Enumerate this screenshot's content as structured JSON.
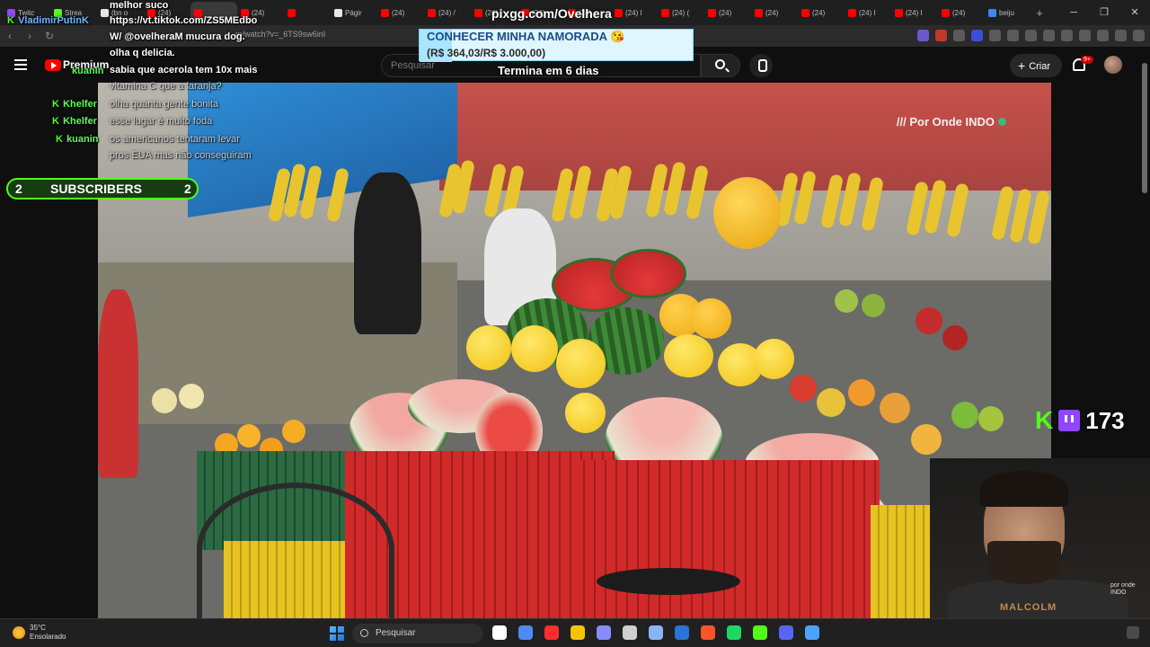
{
  "browser": {
    "tabs": [
      {
        "label": "Twitc",
        "color": "#9146ff"
      },
      {
        "label": "Strea",
        "color": "#53fc18"
      },
      {
        "label": "(bn o",
        "color": "#e6e6e6"
      },
      {
        "label": "(24)",
        "color": "#ff0000"
      },
      {
        "label": "",
        "color": "#ff0000",
        "active": true
      },
      {
        "label": "(24)",
        "color": "#ff0000"
      },
      {
        "label": "",
        "color": "#ff0000"
      },
      {
        "label": "Págir",
        "color": "#e6e6e6"
      },
      {
        "label": "(24)",
        "color": "#ff0000"
      },
      {
        "label": "(24) /",
        "color": "#ff0000"
      },
      {
        "label": "(24) (",
        "color": "#ff0000"
      },
      {
        "label": "(24)",
        "color": "#ff0000"
      },
      {
        "label": "(24)",
        "color": "#ff0000"
      },
      {
        "label": "(24) l",
        "color": "#ff0000"
      },
      {
        "label": "(24) (",
        "color": "#ff0000"
      },
      {
        "label": "(24)",
        "color": "#ff0000"
      },
      {
        "label": "(24)",
        "color": "#ff0000"
      },
      {
        "label": "(24)",
        "color": "#ff0000"
      },
      {
        "label": "(24) l",
        "color": "#ff0000"
      },
      {
        "label": "(24) l",
        "color": "#ff0000"
      },
      {
        "label": "(24)",
        "color": "#ff0000"
      },
      {
        "label": "beiju",
        "color": "#4285f4"
      }
    ],
    "new_tab": "+",
    "url": "m/watch?v=_6TS9sw6inI"
  },
  "youtube": {
    "brand": "Premium",
    "search_placeholder": "Pesquisar",
    "create_label": "Criar",
    "notification_count": "9+"
  },
  "overlay": {
    "chat": [
      {
        "user": "",
        "text": "melhor suco"
      },
      {
        "user": "VladimirPutinK",
        "text": "https://vt.tiktok.com/ZS5MEdbo"
      },
      {
        "user": "kuanin",
        "text": "W/ @ovelheraM mucura dog."
      },
      {
        "user": "",
        "text": "olha q delicia."
      },
      {
        "user": "",
        "text": "sabia que acerola tem 10x mais"
      },
      {
        "user": "",
        "text": "vitamina C que a laranja?"
      },
      {
        "user": "Khelfer",
        "text": "olha quanta gente bonita"
      },
      {
        "user": "Khelfer",
        "text": "esse lugar é muito foda"
      },
      {
        "user": "kuanin",
        "text": "os americanos tentaram levar"
      },
      {
        "user": "",
        "text": "pros EUA mas não conseguiram"
      }
    ],
    "pix_url": "pixgg.com/Ovelhera",
    "goal_title": "CONHECER MINHA NAMORADA 😘",
    "goal_amount": "(R$ 364,03/R$ 3.000,00)",
    "goal_progress": 0.12,
    "goal_end": "Termina em 6 dias",
    "subs_label": "SUBSCRIBERS",
    "subs_left": "2",
    "subs_right": "2",
    "viewer_count": "173",
    "watermark": "/// Por Onde INDO",
    "shirt_text": "MALCOLM",
    "corner_logo": "por onde INDO"
  },
  "taskbar": {
    "temperature": "35°C",
    "condition": "Ensolarado",
    "search_label": "Pesquisar",
    "apps": [
      "#ffffff",
      "#4c8bf5",
      "#ff2d2d",
      "#f5c400",
      "#8a8aff",
      "#cfcfcf",
      "#8ab4f8",
      "#2a74d6",
      "#fb542b",
      "#1ed760",
      "#53fc18",
      "#5865f2",
      "#4aa3ff"
    ]
  }
}
